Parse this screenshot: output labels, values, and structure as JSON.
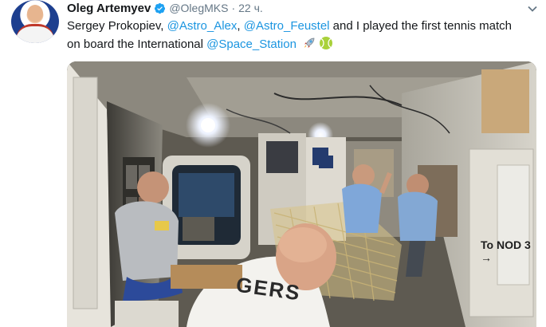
{
  "tweet": {
    "author_name": "Oleg Artemyev",
    "handle": "@OlegMKS",
    "separator": "·",
    "time": "22 ч.",
    "text_parts": {
      "p1": "Sergey Prokopiev, ",
      "m1": "@Astro_Alex",
      "p2": ", ",
      "m2": "@Astro_Feustel",
      "p3": " and I played the first tennis match on board the International ",
      "m3": "@Space_Station"
    },
    "emojis": [
      "rocket-emoji",
      "tennis-ball-emoji"
    ]
  },
  "media": {
    "sign_text": "To NOD 3 →",
    "shirt_text": "GERS"
  },
  "colors": {
    "link": "#1b95e0",
    "secondary": "#657786",
    "verified": "#1da1f2"
  }
}
